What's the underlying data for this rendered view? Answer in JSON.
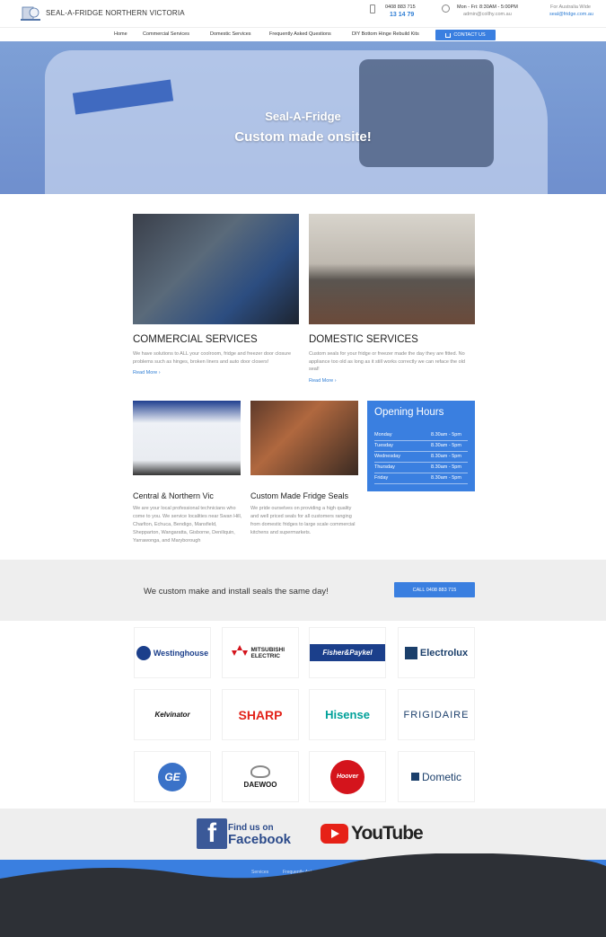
{
  "header": {
    "site_title": "SEAL-A-FRIDGE NORTHERN VICTORIA",
    "phone_primary": "0408 883 715",
    "phone_secondary": "13 14 79",
    "hours": "Mon - Fri: 8:30AM - 5:00PM",
    "email": "admin@collhy.com.au",
    "australia_wide_label": "For Australia Wide",
    "australia_wide_email": "seal@fridge.com.au"
  },
  "nav": {
    "items": [
      "Home",
      "Commercial Services",
      "Domestic Services",
      "Frequently Asked Questions",
      "DIY Bottom Hinge Rebuild Kits"
    ],
    "contact_label": "CONTACT US"
  },
  "hero": {
    "title_line1": "Seal-A-Fridge",
    "title_line2": "Custom made onsite!"
  },
  "services": [
    {
      "title": "COMMERCIAL SERVICES",
      "text": "We have solutions to ALL your coolroom, fridge and freezer door closure problems such as hinges, broken liners and auto door closers!",
      "more": "Read More ›"
    },
    {
      "title": "DOMESTIC SERVICES",
      "text": "Custom seals for your fridge or freezer made the day they are fitted. No appliance too old as long as it still works correctly we can reface the old seal!",
      "more": "Read More ›"
    }
  ],
  "info_blocks": [
    {
      "title": "Central & Northern Vic",
      "text": "We are your local professional technicians who come to you. We service localities near Swan Hill, Charlton, Echuca, Bendigo, Mansfield, Shepparton, Wangaratta, Gisborne, Deniliquin, Yarrawonga, and Maryborough"
    },
    {
      "title": "Custom Made Fridge Seals",
      "text": "We pride ourselves on providing a high quality and well priced seals for all customers ranging from domestic fridges to large scale commercial kitchens and supermarkets."
    }
  ],
  "opening_hours": {
    "title": "Opening Hours",
    "rows": [
      {
        "day": "Monday",
        "time": "8.30am - 5pm"
      },
      {
        "day": "Tuesday",
        "time": "8.30am - 5pm"
      },
      {
        "day": "Wednesday",
        "time": "8.30am - 5pm"
      },
      {
        "day": "Thursday",
        "time": "8.30am - 5pm"
      },
      {
        "day": "Friday",
        "time": "8.30am - 5pm"
      }
    ]
  },
  "cta": {
    "text": "We custom make and install seals the same day!",
    "button": "CALL 0408 883 715"
  },
  "brands": [
    "Westinghouse",
    "MITSUBISHI ELECTRIC",
    "Fisher&Paykel",
    "Electrolux",
    "Kelvinator",
    "SHARP",
    "Hisense",
    "FRIGIDAIRE",
    "GE",
    "DAEWOO",
    "Hoover",
    "Dometic"
  ],
  "social": {
    "fb_line1": "Find us on",
    "fb_line2": "Facebook",
    "yt_text": "YouTube"
  },
  "footer": {
    "links": [
      "Services",
      "Frequently Asked Questions"
    ]
  },
  "colors": {
    "accent": "#3a7fe0",
    "hero_overlay": "#6f8fce",
    "footer_dark": "#2d3036"
  }
}
